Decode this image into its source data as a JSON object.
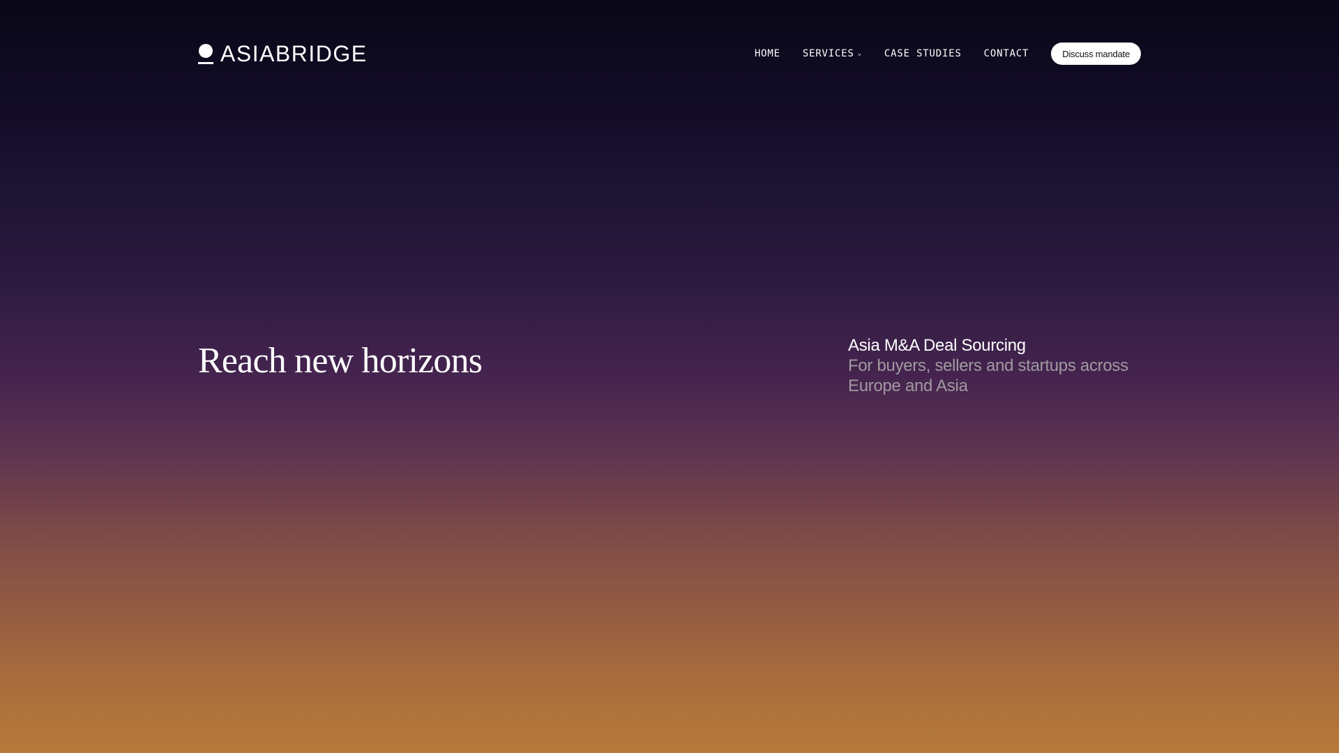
{
  "brand": {
    "name": "ASIABRIDGE",
    "logo_icon": "person-marker-icon"
  },
  "nav": {
    "items": [
      {
        "label": "HOME"
      },
      {
        "label": "SERVICES",
        "has_dropdown": true
      },
      {
        "label": "CASE STUDIES"
      },
      {
        "label": "CONTACT"
      }
    ],
    "cta_label": "Discuss mandate"
  },
  "hero": {
    "title": "Reach new horizons",
    "subtitle_heading": "Asia M&A Deal Sourcing",
    "subtitle_text": "For buyers, sellers and startups across Europe and Asia"
  },
  "colors": {
    "gradient_top": "#090717",
    "gradient_mid": "#45244f",
    "gradient_bottom": "#b67a3a",
    "muted_text": "#a09aa0"
  }
}
